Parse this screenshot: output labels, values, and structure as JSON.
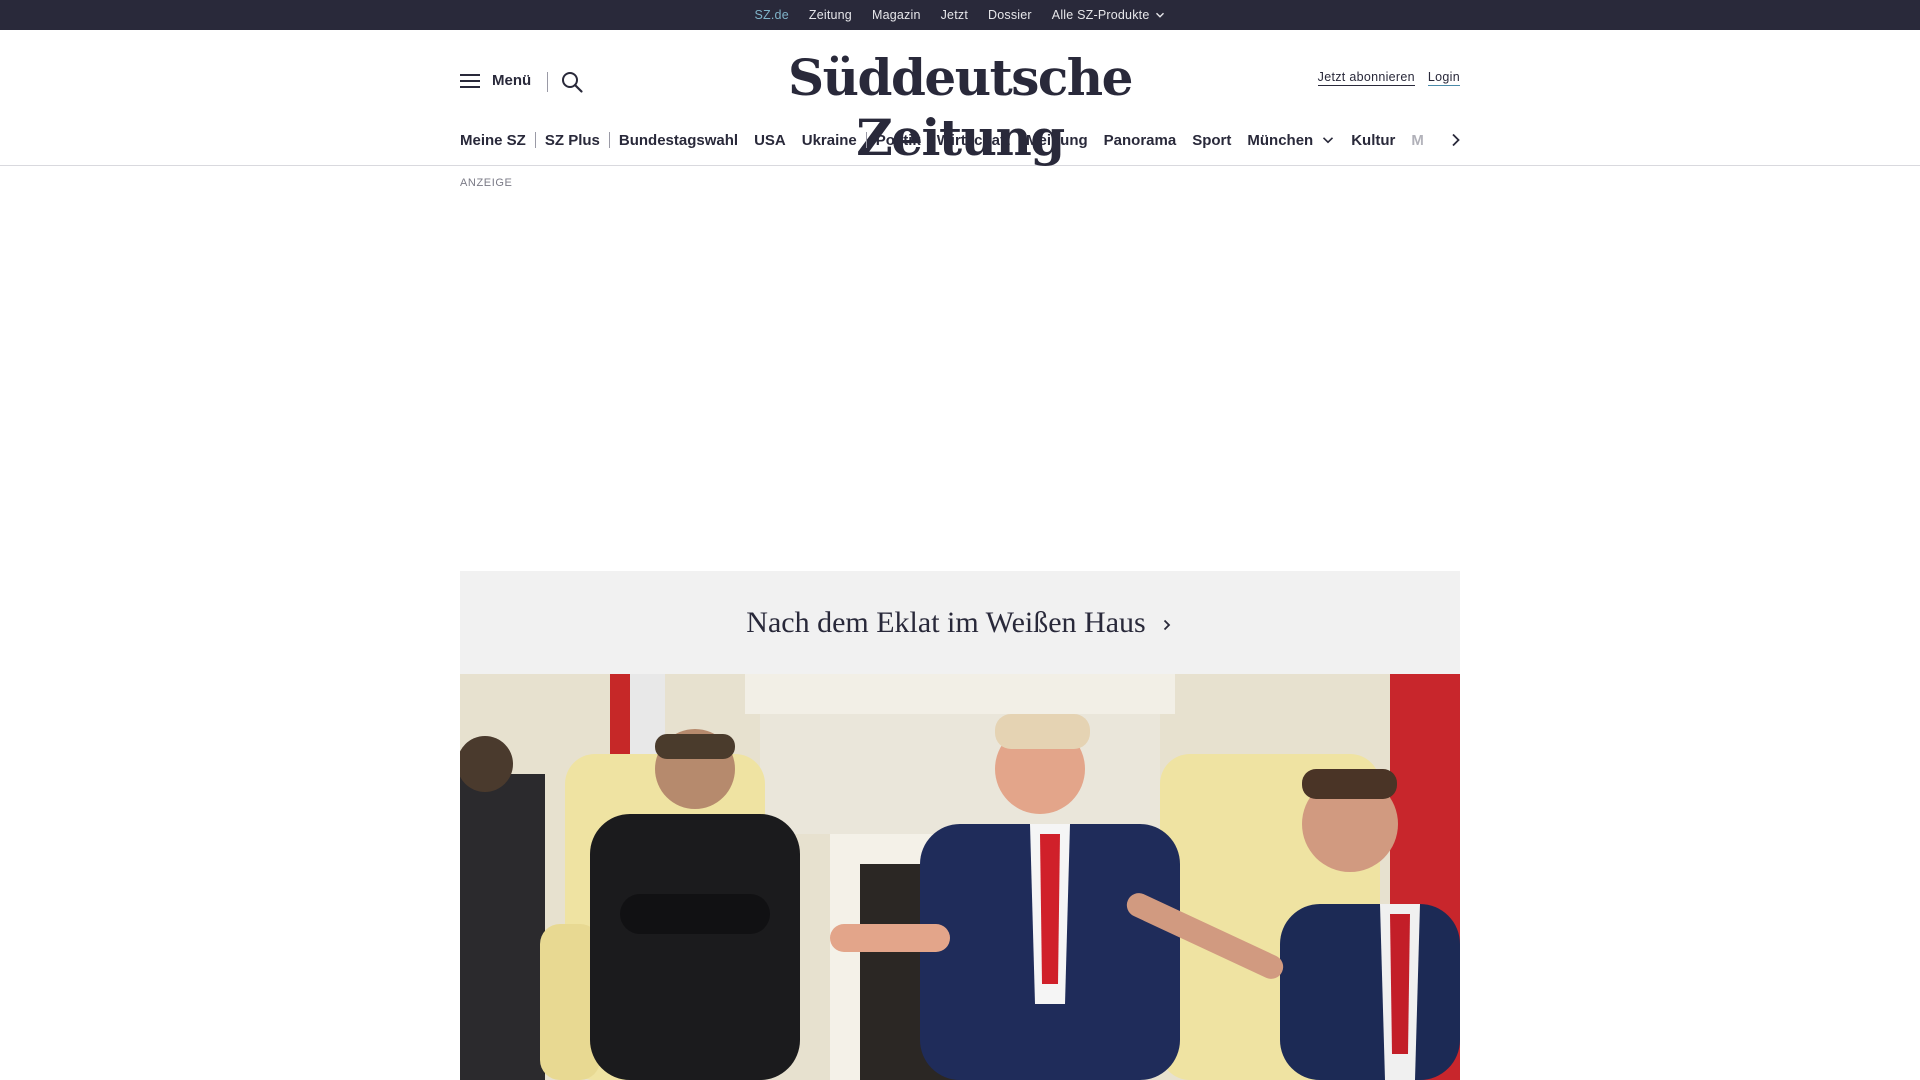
{
  "topbar": {
    "links": [
      {
        "label": "SZ.de"
      },
      {
        "label": "Zeitung"
      },
      {
        "label": "Magazin"
      },
      {
        "label": "Jetzt"
      },
      {
        "label": "Dossier"
      },
      {
        "label": "Alle SZ-Produkte"
      }
    ]
  },
  "header": {
    "menu_label": "Menü",
    "logo_text": "Süddeutsche Zeitung",
    "subscribe_label": "Jetzt abonnieren",
    "login_label": "Login"
  },
  "nav": {
    "items": [
      {
        "label": "Meine SZ"
      },
      {
        "label": "SZ Plus"
      },
      {
        "label": "Bundestagswahl"
      },
      {
        "label": "USA"
      },
      {
        "label": "Ukraine"
      },
      {
        "label": "Politik"
      },
      {
        "label": "Wirtschaft"
      },
      {
        "label": "Meinung"
      },
      {
        "label": "Panorama"
      },
      {
        "label": "Sport"
      },
      {
        "label": "München"
      },
      {
        "label": "Kultur"
      },
      {
        "label": "M"
      }
    ]
  },
  "ad": {
    "label": "ANZEIGE"
  },
  "teaser": {
    "title": "Nach dem Eklat im Weißen Haus"
  },
  "colors": {
    "topbar_bg": "#29293a",
    "active_link": "#7fb3c9",
    "teaser_bg": "#f1f1f1"
  },
  "icons": [
    "hamburger-icon",
    "search-icon",
    "chevron-down-icon",
    "chevron-right-icon"
  ]
}
